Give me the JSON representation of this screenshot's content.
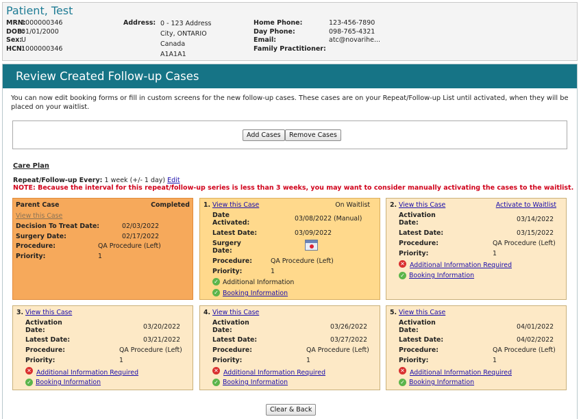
{
  "patient": {
    "name": "Patient, Test",
    "mrn_label": "MRN:",
    "mrn": "1000000346",
    "dob_label": "DOB:",
    "dob": "01/01/2000",
    "sex_label": "Sex:",
    "sex": "U",
    "hcn_label": "HCN:",
    "hcn": "1000000346",
    "address_label": "Address:",
    "address_lines": [
      "0 - 123 Address",
      "City, ONTARIO",
      "Canada",
      "A1A1A1"
    ],
    "home_phone_label": "Home Phone:",
    "home_phone": "123-456-7890",
    "day_phone_label": "Day Phone:",
    "day_phone": "098-765-4321",
    "email_label": "Email:",
    "email": "atc@novarihe...",
    "fp_label": "Family Practitioner:",
    "fp": ""
  },
  "panel": {
    "title": "Review Created Follow-up Cases",
    "intro": "You can now edit booking forms or fill in custom screens for the new follow-up cases. These cases are on your Repeat/Follow-up List until activated, when they will be placed on your waitlist.",
    "add_cases": "Add Cases",
    "remove_cases": "Remove Cases",
    "care_plan": "Care Plan",
    "repeat_label": "Repeat/Follow-up Every:",
    "repeat_value": "1 week (+/- 1 day)",
    "edit": "Edit",
    "note": "NOTE: Because the interval for this repeat/follow-up series is less than 3 weeks, you may want to consider manually activating the cases to the waitlist.",
    "clear_back": "Clear & Back"
  },
  "parent_case": {
    "title": "Parent Case",
    "status": "Completed",
    "view": "View this Case",
    "dtt_label": "Decision To Treat Date:",
    "dtt": "02/03/2022",
    "surgery_label": "Surgery Date:",
    "surgery": "02/17/2022",
    "procedure_label": "Procedure:",
    "procedure": "QA Procedure (Left)",
    "priority_label": "Priority:",
    "priority": "1"
  },
  "case1": {
    "num": "1.",
    "view": "View this Case",
    "status": "On Waitlist",
    "date_activated_label": "Date Activated:",
    "date_activated": "03/08/2022 (Manual)",
    "latest_label": "Latest Date:",
    "latest": "03/09/2022",
    "surgery_label": "Surgery Date:",
    "procedure_label": "Procedure:",
    "procedure": "QA Procedure (Left)",
    "priority_label": "Priority:",
    "priority": "1",
    "additional": "Additional Information",
    "booking": "Booking Information"
  },
  "cases": [
    {
      "num": "2.",
      "view": "View this Case",
      "activate": "Activate to Waitlist",
      "activation_label": "Activation Date:",
      "activation": "03/14/2022",
      "latest_label": "Latest Date:",
      "latest": "03/15/2022",
      "procedure_label": "Procedure:",
      "procedure": "QA Procedure (Left)",
      "priority_label": "Priority:",
      "priority": "1",
      "additional": "Additional Information Required",
      "booking": "Booking Information"
    },
    {
      "num": "3.",
      "view": "View this Case",
      "activation_label": "Activation Date:",
      "activation": "03/20/2022",
      "latest_label": "Latest Date:",
      "latest": "03/21/2022",
      "procedure_label": "Procedure:",
      "procedure": "QA Procedure (Left)",
      "priority_label": "Priority:",
      "priority": "1",
      "additional": "Additional Information Required",
      "booking": "Booking Information"
    },
    {
      "num": "4.",
      "view": "View this Case",
      "activation_label": "Activation Date:",
      "activation": "03/26/2022",
      "latest_label": "Latest Date:",
      "latest": "03/27/2022",
      "procedure_label": "Procedure:",
      "procedure": "QA Procedure (Left)",
      "priority_label": "Priority:",
      "priority": "1",
      "additional": "Additional Information Required",
      "booking": "Booking Information"
    },
    {
      "num": "5.",
      "view": "View this Case",
      "activation_label": "Activation Date:",
      "activation": "04/01/2022",
      "latest_label": "Latest Date:",
      "latest": "04/02/2022",
      "procedure_label": "Procedure:",
      "procedure": "QA Procedure (Left)",
      "priority_label": "Priority:",
      "priority": "1",
      "additional": "Additional Information Required",
      "booking": "Booking Information"
    }
  ],
  "icons": {
    "error": "x-circle-icon",
    "ok": "check-circle-icon",
    "calendar": "calendar-icon"
  },
  "colors": {
    "header": "#167486",
    "parent_card": "#f6a95b",
    "active_card": "#ffd98c",
    "pending_card": "#fde9c6",
    "note": "#d0021b"
  }
}
